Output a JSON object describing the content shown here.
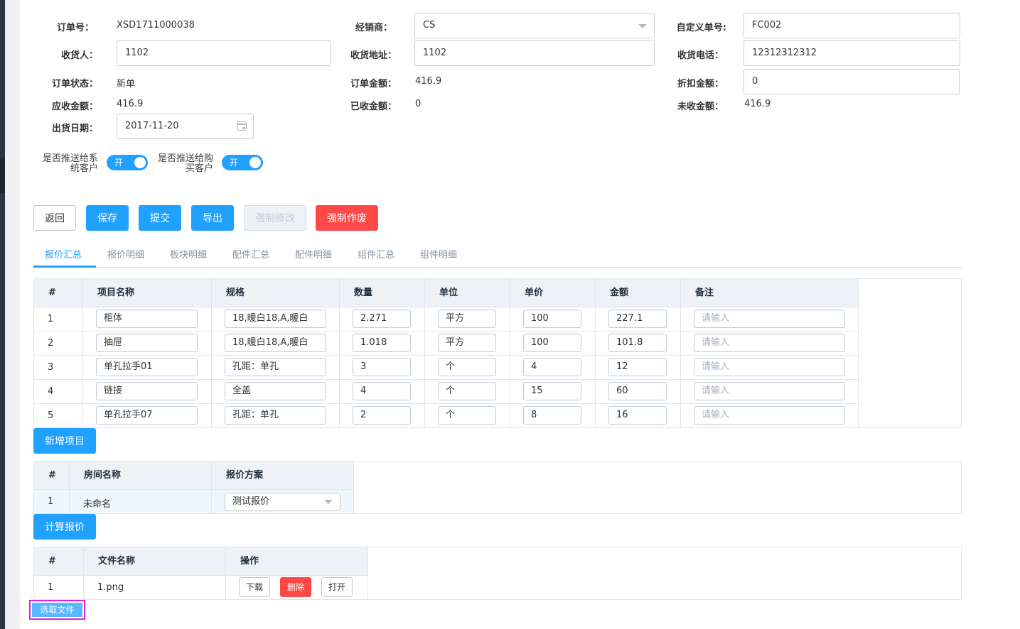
{
  "form": {
    "order_no_label": "订单号：",
    "order_no": "XSD1711000038",
    "dealer_label": "经销商：",
    "dealer": "CS",
    "custom_no_label": "自定义单号:",
    "custom_no": "FC002",
    "consignee_label": "收货人：",
    "consignee": "1102",
    "address_label": "收货地址：",
    "address": "1102",
    "phone_label": "收货电话：",
    "phone": "12312312312",
    "status_label": "订单状态：",
    "status": "新单",
    "amount_label": "订单金额：",
    "amount": "416.9",
    "discount_label": "折扣金额：",
    "discount": "0",
    "receivable_label": "应收金额：",
    "receivable": "416.9",
    "received_label": "已收金额：",
    "received": "0",
    "unreceived_label": "未收金额：",
    "unreceived": "416.9",
    "ship_date_label": "出货日期：",
    "ship_date": "2017-11-20"
  },
  "toggles": {
    "system_label_1": "是否推送给系",
    "system_label_2": "统客户",
    "system_state": "开",
    "buyer_label_1": "是否推送给购",
    "buyer_label_2": "买客户",
    "buyer_state": "开"
  },
  "actions": {
    "back": "返回",
    "save": "保存",
    "submit": "提交",
    "export": "导出",
    "force_edit": "强制修改",
    "force_void": "强制作废"
  },
  "tabs": [
    "报价汇总",
    "报价明细",
    "板块明细",
    "配件汇总",
    "配件明细",
    "组件汇总",
    "组件明细"
  ],
  "quote_table": {
    "headers": [
      "#",
      "项目名称",
      "规格",
      "数量",
      "单位",
      "单价",
      "金额",
      "备注"
    ],
    "remark_placeholder": "请输入",
    "rows": [
      {
        "no": "1",
        "name": "柜体",
        "spec": "18,暖白18,A,暖白",
        "qty": "2.271",
        "unit": "平方",
        "price": "100",
        "amount": "227.1"
      },
      {
        "no": "2",
        "name": "抽屉",
        "spec": "18,暖白18,A,暖白",
        "qty": "1.018",
        "unit": "平方",
        "price": "100",
        "amount": "101.8"
      },
      {
        "no": "3",
        "name": "单孔拉手01",
        "spec": "孔距：单孔",
        "qty": "3",
        "unit": "个",
        "price": "4",
        "amount": "12"
      },
      {
        "no": "4",
        "name": "链接",
        "spec": "全盖",
        "qty": "4",
        "unit": "个",
        "price": "15",
        "amount": "60"
      },
      {
        "no": "5",
        "name": "单孔拉手07",
        "spec": "孔距：单孔",
        "qty": "2",
        "unit": "个",
        "price": "8",
        "amount": "16"
      }
    ]
  },
  "add_item_button": "新增项目",
  "room_table": {
    "headers": [
      "#",
      "房间名称",
      "报价方案"
    ],
    "rows": [
      {
        "no": "1",
        "room": "未命名",
        "plan": "测试报价"
      }
    ]
  },
  "calc_button": "计算报价",
  "file_table": {
    "headers": [
      "#",
      "文件名称",
      "操作"
    ],
    "rows": [
      {
        "no": "1",
        "file": "1.png",
        "download": "下载",
        "delete": "删除",
        "open": "打开"
      }
    ]
  },
  "choose_file_button": "选取文件",
  "colors": {
    "primary": "#20a0ff",
    "danger": "#ff4949",
    "highlight": "#e020e0"
  }
}
